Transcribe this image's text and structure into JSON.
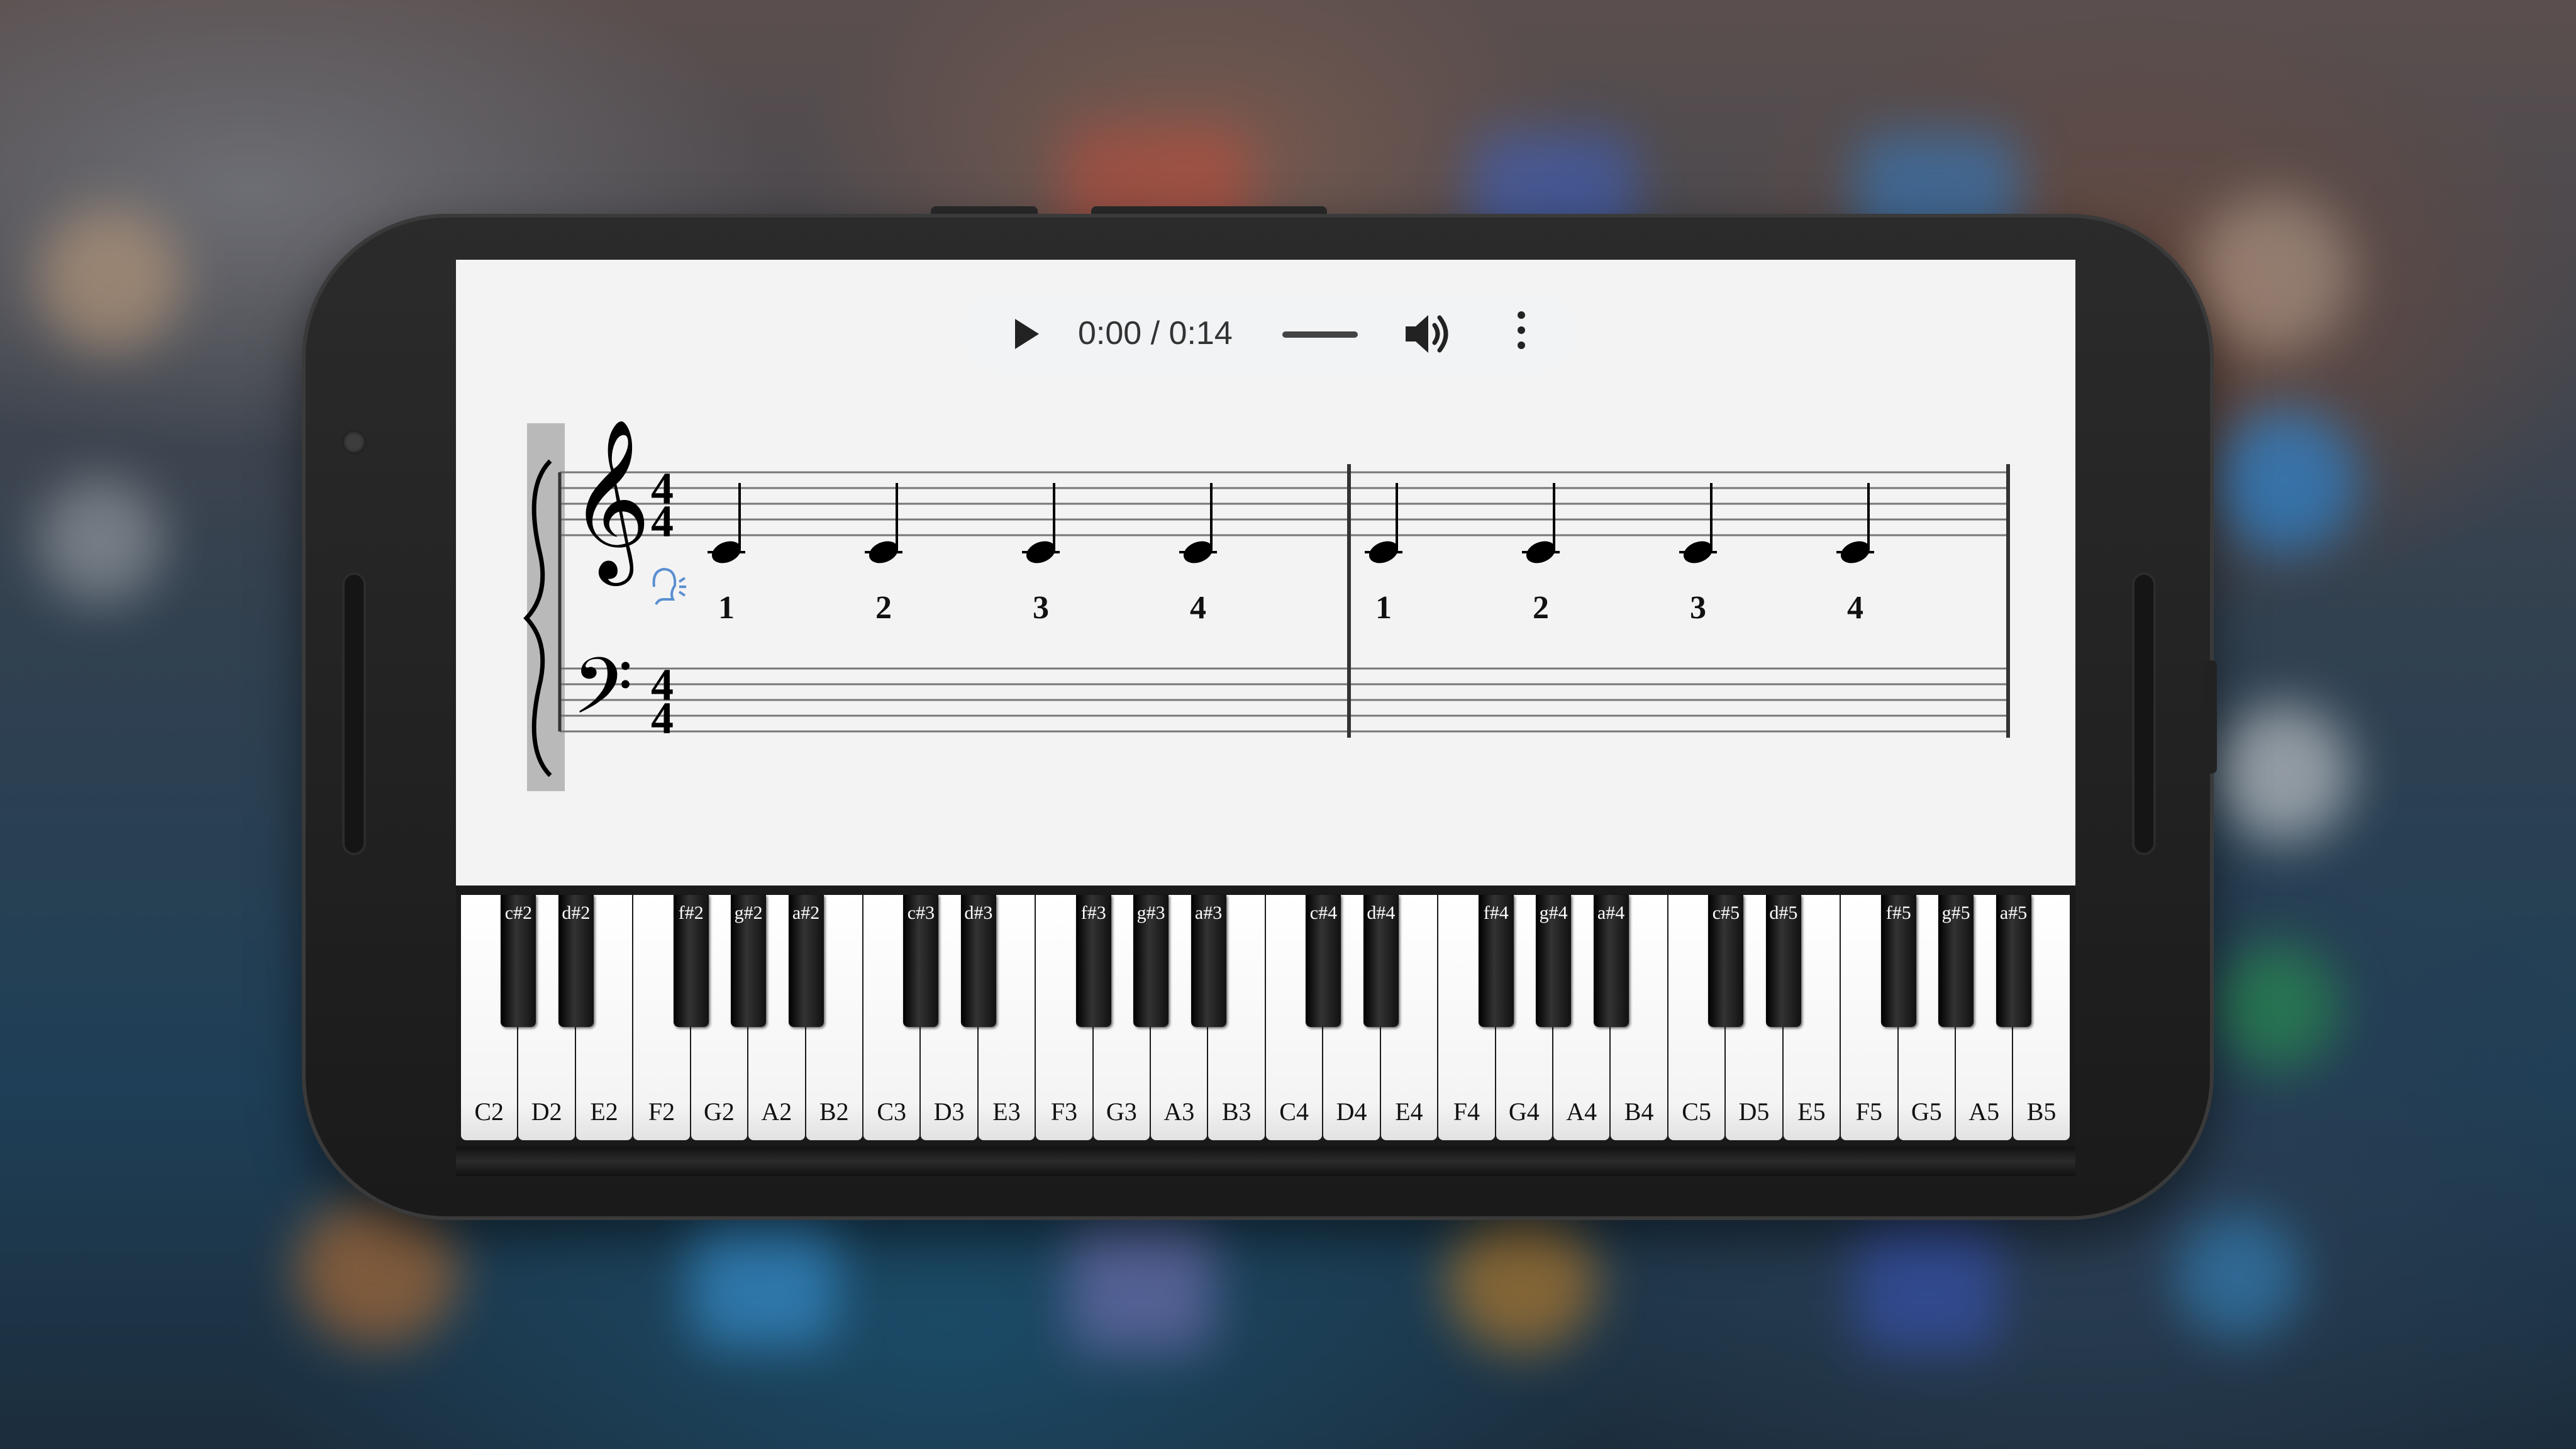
{
  "player": {
    "time": "0:00 / 0:14",
    "progress": 0.0,
    "play_icon": "play-icon",
    "volume_icon": "volume-icon",
    "menu_icon": "more-vert-icon"
  },
  "score": {
    "treble_time_signature": {
      "top": "4",
      "bottom": "4"
    },
    "bass_time_signature": {
      "top": "4",
      "bottom": "4"
    },
    "measures": [
      {
        "notes": [
          "C",
          "C",
          "C",
          "C"
        ],
        "counts": [
          "1",
          "2",
          "3",
          "4"
        ]
      },
      {
        "notes": [
          "C",
          "C",
          "C",
          "C"
        ],
        "counts": [
          "1",
          "2",
          "3",
          "4"
        ]
      }
    ]
  },
  "piano": {
    "white_keys": [
      "C2",
      "D2",
      "E2",
      "F2",
      "G2",
      "A2",
      "B2",
      "C3",
      "D3",
      "E3",
      "F3",
      "G3",
      "A3",
      "B3",
      "C4",
      "D4",
      "E4",
      "F4",
      "G4",
      "A4",
      "B4",
      "C5",
      "D5",
      "E5",
      "F5",
      "G5",
      "A5",
      "B5"
    ],
    "black_keys": [
      {
        "label": "c#2",
        "after": 0
      },
      {
        "label": "d#2",
        "after": 1
      },
      {
        "label": "f#2",
        "after": 3
      },
      {
        "label": "g#2",
        "after": 4
      },
      {
        "label": "a#2",
        "after": 5
      },
      {
        "label": "c#3",
        "after": 7
      },
      {
        "label": "d#3",
        "after": 8
      },
      {
        "label": "f#3",
        "after": 10
      },
      {
        "label": "g#3",
        "after": 11
      },
      {
        "label": "a#3",
        "after": 12
      },
      {
        "label": "c#4",
        "after": 14
      },
      {
        "label": "d#4",
        "after": 15
      },
      {
        "label": "f#4",
        "after": 17
      },
      {
        "label": "g#4",
        "after": 18
      },
      {
        "label": "a#4",
        "after": 19
      },
      {
        "label": "c#5",
        "after": 21
      },
      {
        "label": "d#5",
        "after": 22
      },
      {
        "label": "f#5",
        "after": 24
      },
      {
        "label": "g#5",
        "after": 25
      },
      {
        "label": "a#5",
        "after": 26
      }
    ]
  }
}
